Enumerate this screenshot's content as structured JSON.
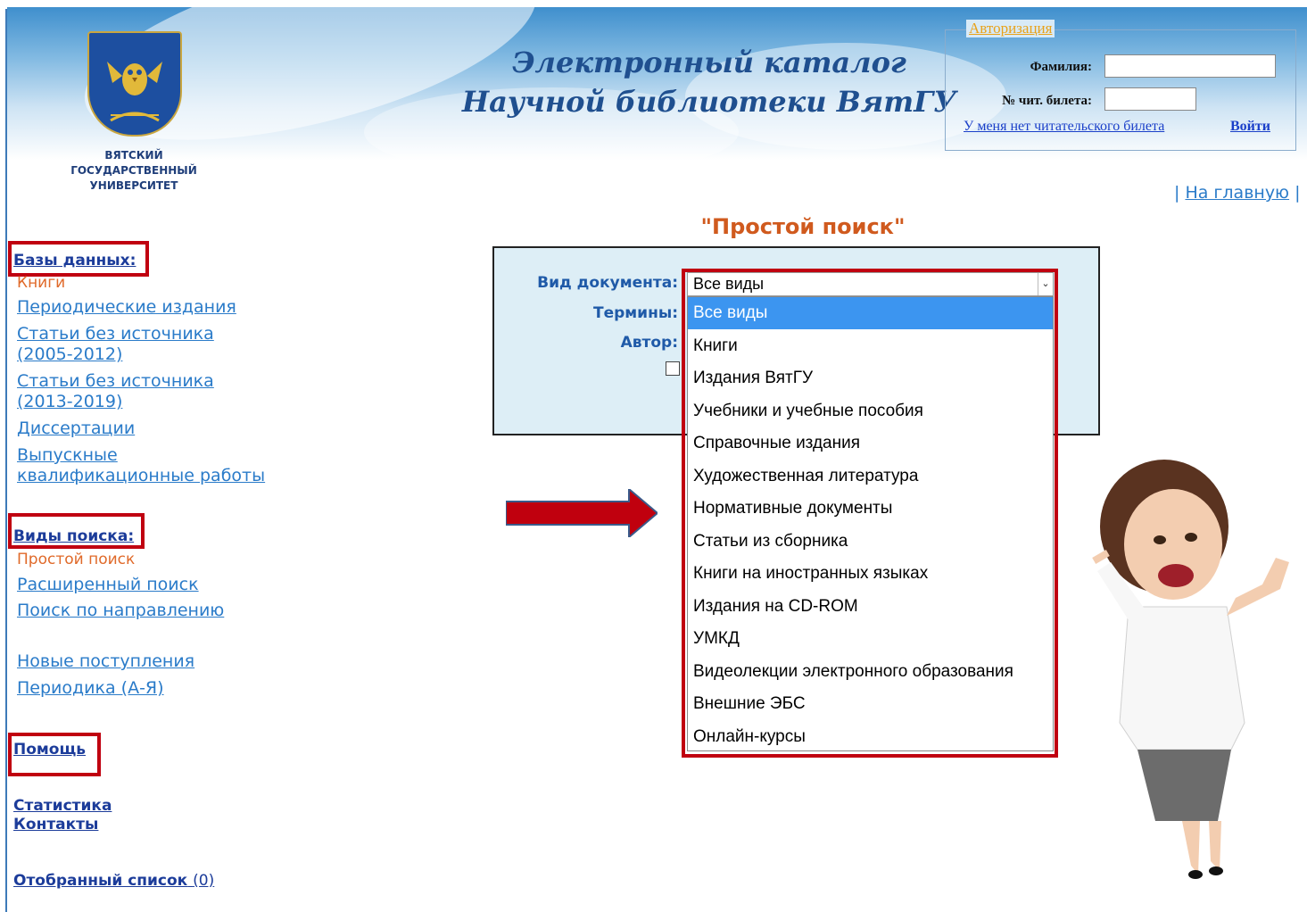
{
  "header": {
    "university_name": [
      "ВЯТСКИЙ",
      "ГОСУДАРСТВЕННЫЙ",
      "УНИВЕРСИТЕТ"
    ],
    "title_line1": "Электронный каталог",
    "title_line2": "Научной библиотеки ВятГУ"
  },
  "auth": {
    "legend": "Авторизация",
    "surname_label": "Фамилия:",
    "surname_value": "",
    "ticket_label": "№ чит. билета:",
    "ticket_value": "",
    "no_ticket_link": "У меня нет читательского билета",
    "login_link": "Войти"
  },
  "home": {
    "prefix": "| ",
    "link": "На главную",
    "suffix": " |"
  },
  "sidebar": {
    "databases_heading": "Базы данных:",
    "databases_active": "Книги",
    "databases": [
      [
        "Периодические издания"
      ],
      [
        "Статьи без источника",
        "(2005-2012)"
      ],
      [
        "Статьи без источника",
        "(2013-2019)"
      ],
      [
        "Диссертации"
      ],
      [
        "Выпускные",
        "квалификационные работы"
      ]
    ],
    "search_heading": "Виды поиска:",
    "search_active": "Простой поиск",
    "search_links": [
      "Расширенный поиск",
      "Поиск по направлению"
    ],
    "extra_links": [
      "Новые поступления",
      "Периодика (А-Я)"
    ],
    "help": "Помощь",
    "stats": "Статистика",
    "contacts": "Контакты",
    "selected_list": "Отобранный список",
    "selected_count": "(0)"
  },
  "main": {
    "heading": "\"Простой поиск\"",
    "doc_type_label": "Вид документа:",
    "terms_label": "Термины:",
    "author_label": "Автор:",
    "doc_type_value": "Все виды",
    "dropdown_options": [
      "Все виды",
      "Книги",
      "Издания ВятГУ",
      "Учебники и учебные пособия",
      "Справочные издания",
      "Художественная литература",
      "Нормативные документы",
      "Статьи из сборника",
      "Книги на иностранных языках",
      "Издания на CD-ROM",
      "УМКД",
      "Видеолекции электронного образования",
      "Внешние ЭБС",
      "Онлайн-курсы"
    ],
    "dropdown_selected_index": 0
  },
  "colors": {
    "highlight_box": "#c00010",
    "link": "#2a7bc9",
    "active_item": "#e06a2a",
    "heading": "#d05a1e",
    "dropdown_selected": "#3c95f0"
  },
  "icons": {
    "emblem": "owl-coat-of-arms-icon",
    "arrow": "red-arrow-right-icon",
    "select_arrow": "chevron-down-icon"
  }
}
